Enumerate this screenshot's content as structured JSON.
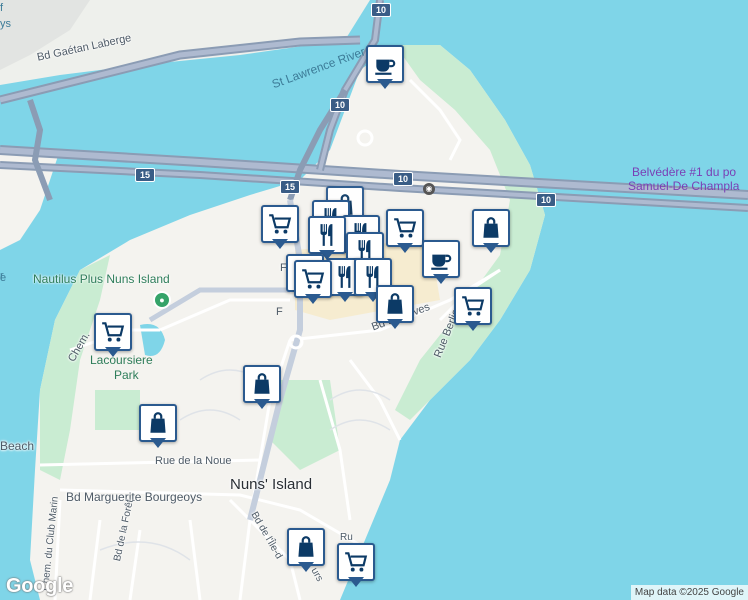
{
  "map": {
    "labels": {
      "bd_gaetan_laberge": "Bd Gaétan Laberge",
      "st_lawrence_river": "St Lawrence River",
      "belvedere": "Belvédère #1 du po",
      "belvedere2": "Samuel-De Champla",
      "nautilus": "Nautilus Plus Nuns Island",
      "lacoursiere": "Lacoursiere",
      "lacoursiere2": "Park",
      "beach": "Beach",
      "rue_de_la_noue": "Rue de la Noue",
      "nuns_island": "Nuns' Island",
      "bd_marguerite": "Bd Marguerite Bourgeoys",
      "rue_berlioz": "Rue Berlioz",
      "bd_leves": "Bd de Léves",
      "bd_leves2": "que",
      "chem": "Chem.",
      "chem_club_marin": "Chem. du Club Marin",
      "bd_foret": "Bd de la Forêt",
      "bd_ile": "Bd de l'Île-d",
      "r_frag": "R",
      "ru_frag": "Ru",
      "ters_frag": "urs",
      "f_frag": "F",
      "ys_frag": "ys",
      "ve_frag": "e"
    },
    "highways": {
      "h10_top": "10",
      "h10_mid": "10",
      "h10_bridge": "10",
      "h10_right": "10",
      "h15_left": "15",
      "h15_mid": "15"
    },
    "markers": [
      {
        "icon": "coffee-icon"
      },
      {
        "icon": "shopping-bag-icon"
      },
      {
        "icon": "cart-icon"
      },
      {
        "icon": "restaurant-icon"
      },
      {
        "icon": "coffee-icon"
      },
      {
        "icon": "shopping-bag-icon"
      },
      {
        "icon": "cart-icon"
      },
      {
        "icon": "shopping-bag-icon"
      },
      {
        "icon": "cart-icon"
      },
      {
        "icon": "shopping-bag-icon"
      },
      {
        "icon": "shopping-bag-icon"
      },
      {
        "icon": "cart-icon"
      }
    ],
    "logo": "Google",
    "attribution": "Map data ©2025 Google",
    "colors": {
      "water": "#7fd5e8",
      "land": "#f4f3ef",
      "park": "#c9ecd2",
      "highway": "#8b9cb4",
      "marker_border": "#2b5a8f"
    }
  }
}
